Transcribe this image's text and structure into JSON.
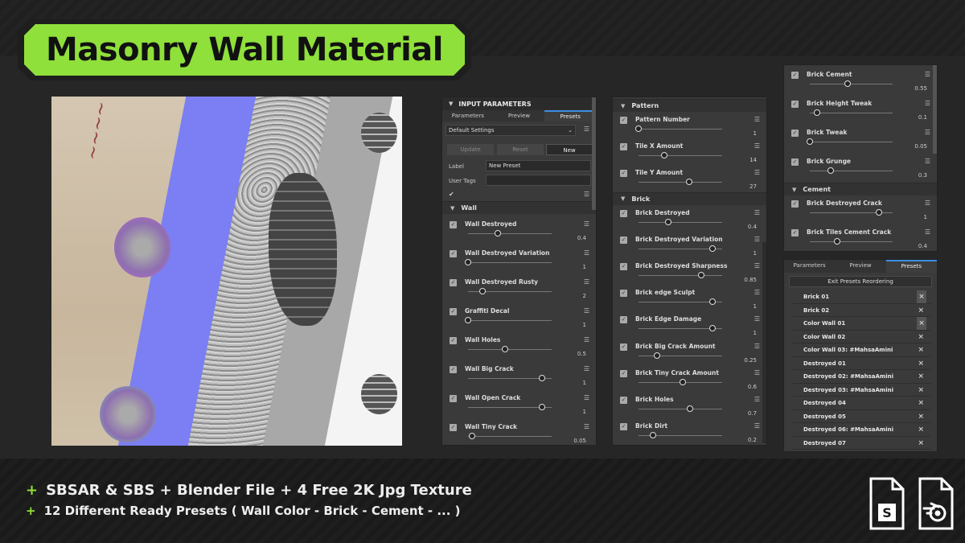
{
  "title": "Masonry Wall Material",
  "colors": {
    "accent_green": "#8fe03a",
    "tab_blue": "#3d8fe0",
    "panel_bg": "#3a3a3a"
  },
  "input_panel": {
    "header": "INPUT PARAMETERS",
    "tabs": [
      "Parameters",
      "Preview",
      "Presets"
    ],
    "active_tab": "Presets",
    "settings_select": "Default Settings",
    "buttons": {
      "update": "Update",
      "reset": "Reset",
      "new": "New"
    },
    "label_caption": "Label",
    "label_value": "New Preset",
    "user_tags_caption": "User Tags",
    "section": "Wall",
    "params": [
      {
        "label": "Wall Destroyed",
        "value": "0.4",
        "level": 0.4
      },
      {
        "label": "Wall Destroyed Variation",
        "value": "1",
        "level": 0.0
      },
      {
        "label": "Wall Destroyed Rusty",
        "value": "2",
        "level": 0.2
      },
      {
        "label": "Graffiti Decal",
        "value": "1",
        "level": 0.0
      },
      {
        "label": "Wall Holes",
        "value": "0.5",
        "level": 0.5
      },
      {
        "label": "Wall Big Crack",
        "value": "1",
        "level": 1.0
      },
      {
        "label": "Wall Open Crack",
        "value": "1",
        "level": 1.0
      },
      {
        "label": "Wall Tiny Crack",
        "value": "0.05",
        "level": 0.05
      }
    ]
  },
  "pattern_panel": {
    "sections": [
      {
        "name": "Pattern",
        "params": [
          {
            "label": "Pattern Number",
            "value": "1",
            "level": 0.0
          },
          {
            "label": "Tile X Amount",
            "value": "14",
            "level": 0.35
          },
          {
            "label": "Tile Y Amount",
            "value": "27",
            "level": 0.68
          }
        ]
      },
      {
        "name": "Brick",
        "params": [
          {
            "label": "Brick Destroyed",
            "value": "0.4",
            "level": 0.4
          },
          {
            "label": "Brick Destroyed Variation",
            "value": "1",
            "level": 1.0
          },
          {
            "label": "Brick Destroyed Sharpness",
            "value": "0.85",
            "level": 0.85
          },
          {
            "label": "Brick edge Sculpt",
            "value": "1",
            "level": 1.0
          },
          {
            "label": "Brick Edge Damage",
            "value": "1",
            "level": 1.0
          },
          {
            "label": "Brick Big Crack Amount",
            "value": "0.25",
            "level": 0.25
          },
          {
            "label": "Brick Tiny Crack Amount",
            "value": "0.6",
            "level": 0.6
          },
          {
            "label": "Brick Holes",
            "value": "0.7",
            "level": 0.7
          },
          {
            "label": "Brick Dirt",
            "value": "0.2",
            "level": 0.2
          }
        ]
      }
    ]
  },
  "cement_panel": {
    "params_top": [
      {
        "label": "Brick Cement",
        "value": "0.55",
        "level": 0.55
      },
      {
        "label": "Brick Height Tweak",
        "value": "0.1",
        "level": 0.1
      },
      {
        "label": "Brick Tweak",
        "value": "0.05",
        "level": 0.0
      },
      {
        "label": "Brick Grunge",
        "value": "0.3",
        "level": 0.3
      }
    ],
    "section": "Cement",
    "params_cement": [
      {
        "label": "Brick Destroyed Crack",
        "value": "1",
        "level": 1.0
      },
      {
        "label": "Brick Tiles Cement Crack",
        "value": "0.4",
        "level": 0.4
      }
    ]
  },
  "presets_panel": {
    "tabs": [
      "Parameters",
      "Preview",
      "Presets"
    ],
    "active_tab": "Presets",
    "exit_button": "Exit Presets Reordering",
    "presets": [
      "Brick 01",
      "Brick 02",
      "Color Wall 01",
      "Color Wall 02",
      "Color Wall 03: #MahsaAmini",
      "Destroyed 01",
      "Destroyed 02: #MahsaAmini",
      "Destroyed 03: #MahsaAmini",
      "Destroyed 04",
      "Destroyed 05",
      "Destroyed 06: #MahsaAmini",
      "Destroyed 07"
    ]
  },
  "features": [
    "SBSAR & SBS + Blender File + 4 Free 2K Jpg Texture",
    "12 Different Ready Presets ( Wall Color - Brick - Cement - ... )"
  ],
  "icons": [
    "substance-file-icon",
    "blender-file-icon"
  ]
}
